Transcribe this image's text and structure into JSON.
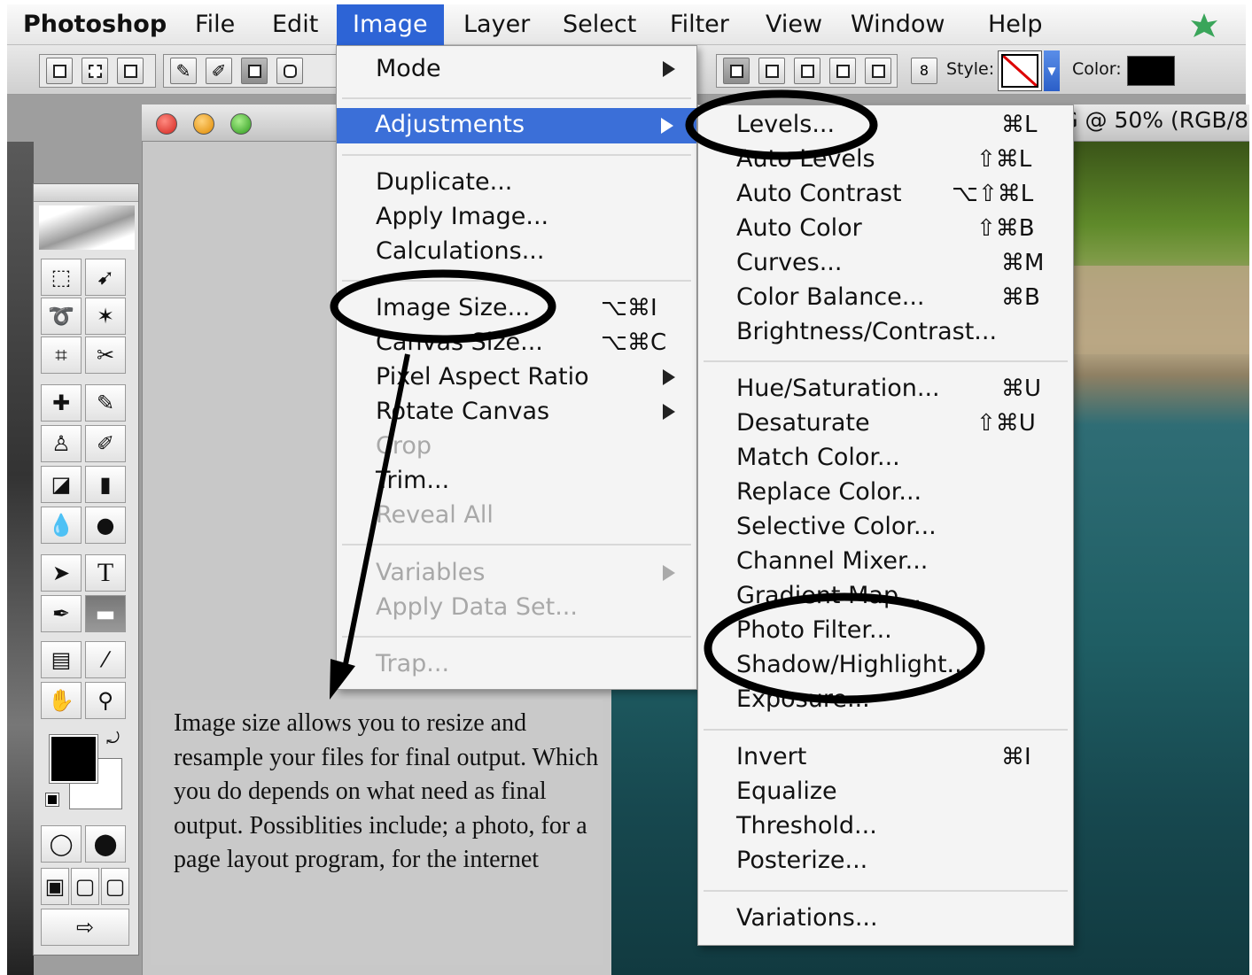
{
  "menubar": {
    "app": "Photoshop",
    "items": [
      "File",
      "Edit",
      "Image",
      "Layer",
      "Select",
      "Filter",
      "View",
      "Window",
      "Help"
    ],
    "active": "Image"
  },
  "options_bar": {
    "style_label": "Style:",
    "color_label": "Color:"
  },
  "document": {
    "title_visible": "P62534 JPG @ 50% (RGB/8"
  },
  "image_menu": {
    "items": [
      {
        "label": "Mode",
        "shortcut": "",
        "submenu": true,
        "disabled": false
      },
      {
        "label": "Adjustments",
        "shortcut": "",
        "submenu": true,
        "disabled": false,
        "highlighted": true
      },
      {
        "label": "Duplicate...",
        "shortcut": "",
        "submenu": false,
        "disabled": false
      },
      {
        "label": "Apply Image...",
        "shortcut": "",
        "submenu": false,
        "disabled": false
      },
      {
        "label": "Calculations...",
        "shortcut": "",
        "submenu": false,
        "disabled": false
      },
      {
        "label": "Image Size...",
        "shortcut": "⌥⌘I",
        "submenu": false,
        "disabled": false
      },
      {
        "label": "Canvas Size...",
        "shortcut": "⌥⌘C",
        "submenu": false,
        "disabled": false
      },
      {
        "label": "Pixel Aspect Ratio",
        "shortcut": "",
        "submenu": true,
        "disabled": false
      },
      {
        "label": "Rotate Canvas",
        "shortcut": "",
        "submenu": true,
        "disabled": false
      },
      {
        "label": "Crop",
        "shortcut": "",
        "submenu": false,
        "disabled": true
      },
      {
        "label": "Trim...",
        "shortcut": "",
        "submenu": false,
        "disabled": false
      },
      {
        "label": "Reveal All",
        "shortcut": "",
        "submenu": false,
        "disabled": true
      },
      {
        "label": "Variables",
        "shortcut": "",
        "submenu": true,
        "disabled": true
      },
      {
        "label": "Apply Data Set...",
        "shortcut": "",
        "submenu": false,
        "disabled": true
      },
      {
        "label": "Trap...",
        "shortcut": "",
        "submenu": false,
        "disabled": true
      }
    ]
  },
  "adjustments_menu": {
    "items": [
      {
        "label": "Levels...",
        "shortcut": "⌘L"
      },
      {
        "label": "Auto Levels",
        "shortcut": "⇧⌘L"
      },
      {
        "label": "Auto Contrast",
        "shortcut": "⌥⇧⌘L"
      },
      {
        "label": "Auto Color",
        "shortcut": "⇧⌘B"
      },
      {
        "label": "Curves...",
        "shortcut": "⌘M"
      },
      {
        "label": "Color Balance...",
        "shortcut": "⌘B"
      },
      {
        "label": "Brightness/Contrast...",
        "shortcut": ""
      },
      {
        "label": "Hue/Saturation...",
        "shortcut": "⌘U"
      },
      {
        "label": "Desaturate",
        "shortcut": "⇧⌘U"
      },
      {
        "label": "Match Color...",
        "shortcut": ""
      },
      {
        "label": "Replace Color...",
        "shortcut": ""
      },
      {
        "label": "Selective Color...",
        "shortcut": ""
      },
      {
        "label": "Channel Mixer...",
        "shortcut": ""
      },
      {
        "label": "Gradient Map...",
        "shortcut": ""
      },
      {
        "label": "Photo Filter...",
        "shortcut": ""
      },
      {
        "label": "Shadow/Highlight...",
        "shortcut": ""
      },
      {
        "label": "Exposure...",
        "shortcut": ""
      },
      {
        "label": "Invert",
        "shortcut": "⌘I"
      },
      {
        "label": "Equalize",
        "shortcut": ""
      },
      {
        "label": "Threshold...",
        "shortcut": ""
      },
      {
        "label": "Posterize...",
        "shortcut": ""
      },
      {
        "label": "Variations...",
        "shortcut": ""
      }
    ]
  },
  "toolbox": {
    "type_tool_glyph": "T"
  },
  "annotation": {
    "text": "Image size allows you to resize and resample your files for final output. Which you do depends on what need as final output. Possiblities include; a photo, for a page layout program, for the internet"
  },
  "colors": {
    "menu_highlight": "#3b6fd8",
    "annotation_ink": "#000000"
  }
}
